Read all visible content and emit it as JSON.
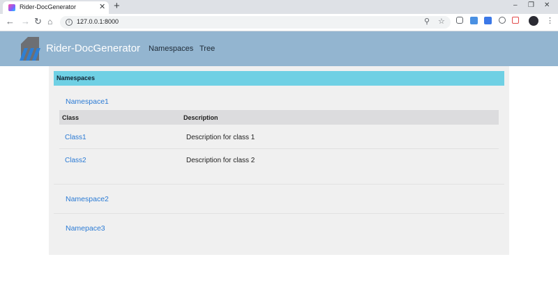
{
  "browser": {
    "tab_title": "Rider-DocGenerator",
    "tab_close": "✕",
    "new_tab": "+",
    "url": "127.0.0.1:8000",
    "win_minimize": "–",
    "win_restore": "❐",
    "win_close": "✕"
  },
  "app": {
    "brand": "Rider-DocGenerator",
    "nav": [
      "Namespaces",
      "Tree"
    ]
  },
  "content": {
    "section_title": "Namespaces",
    "namespaces": [
      {
        "name": "Namespace1",
        "table": {
          "headers": [
            "Class",
            "Description"
          ],
          "rows": [
            {
              "class": "Class1",
              "description": "Description for class 1"
            },
            {
              "class": "Class2",
              "description": "Description for class 2"
            }
          ]
        }
      },
      {
        "name": "Namespace2"
      },
      {
        "name": "Namepace3"
      }
    ]
  },
  "colors": {
    "header_bg": "#93b5d0",
    "section_header_bg": "#6fd0e4",
    "link": "#2a7ad4"
  }
}
